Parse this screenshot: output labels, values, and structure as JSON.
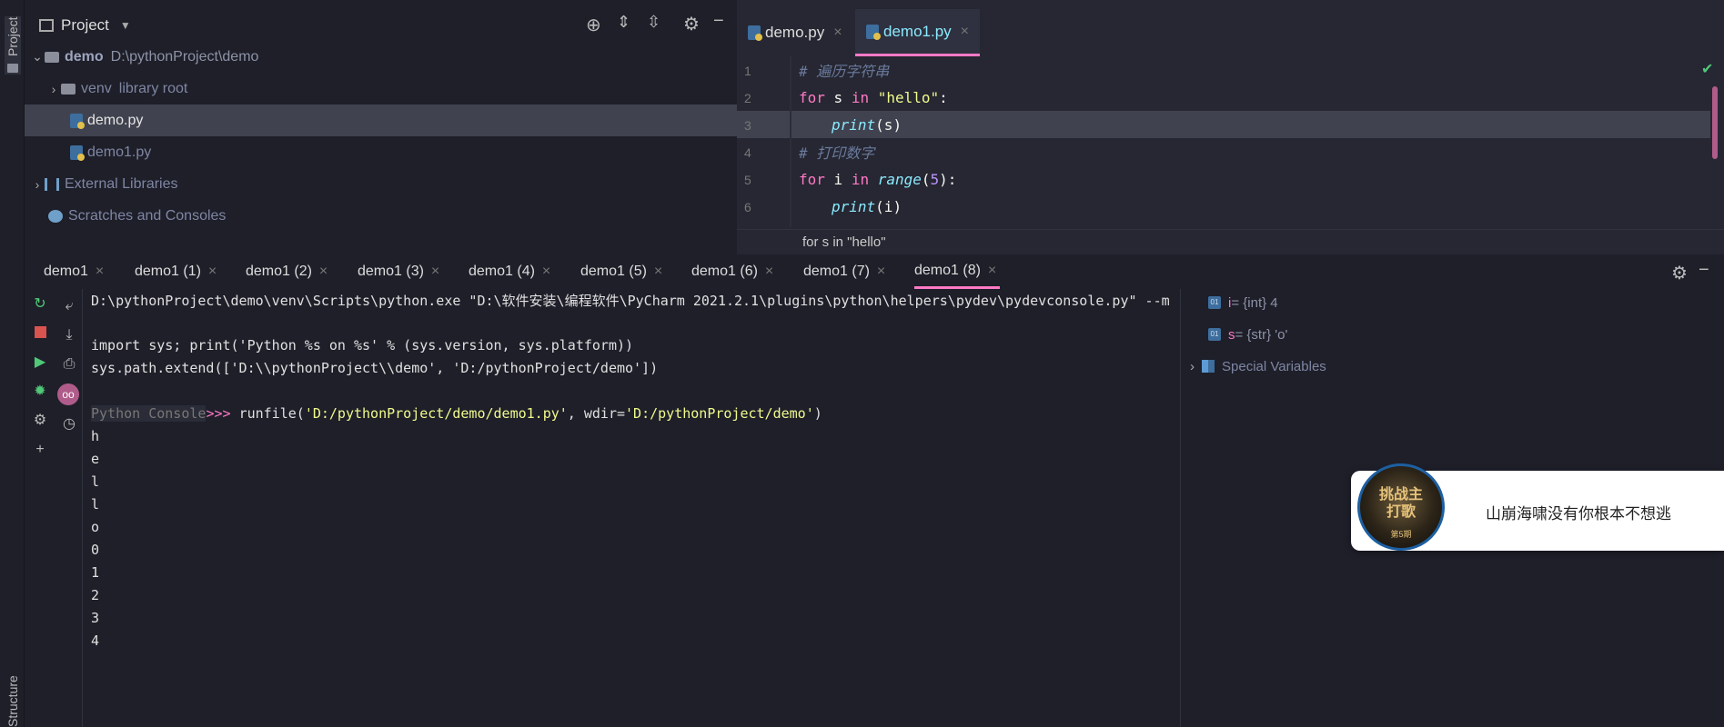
{
  "sidebar": {
    "project_label": "Project",
    "structure_label": "Structure"
  },
  "project_panel": {
    "title": "Project",
    "tree": [
      {
        "name": "demo",
        "path": "D:\\pythonProject\\demo"
      },
      {
        "name": "venv",
        "suffix": "library root"
      },
      {
        "name": "demo.py"
      },
      {
        "name": "demo1.py"
      },
      {
        "name": "External Libraries"
      },
      {
        "name": "Scratches and Consoles"
      }
    ]
  },
  "editor": {
    "tabs": [
      {
        "label": "demo.py"
      },
      {
        "label": "demo1.py",
        "active": true
      }
    ],
    "line_numbers": [
      "1",
      "2",
      "3",
      "4",
      "5",
      "6"
    ],
    "code": {
      "l1": "# 遍历字符串",
      "l2_kw": "for",
      "l2_var": " s ",
      "l2_in": "in",
      "l2_str": " \"hello\"",
      "l2_colon": ":",
      "l3_fn": "print",
      "l3_rest": "(s)",
      "l4": "# 打印数字",
      "l5_kw": "for",
      "l5_var": " i ",
      "l5_in": "in",
      "l5_fn": " range",
      "l5_open": "(",
      "l5_num": "5",
      "l5_close": "):",
      "l6_fn": "print",
      "l6_rest": "(i)"
    },
    "breadcrumb": "for s in \"hello\""
  },
  "run_tabs": [
    "demo1",
    "demo1 (1)",
    "demo1 (2)",
    "demo1 (3)",
    "demo1 (4)",
    "demo1 (5)",
    "demo1 (6)",
    "demo1 (7)",
    "demo1 (8)"
  ],
  "console": {
    "cmd": "D:\\pythonProject\\demo\\venv\\Scripts\\python.exe \"D:\\软件安装\\编程软件\\PyCharm 2021.2.1\\plugins\\python\\helpers\\pydev\\pydevconsole.py\" --m",
    "l1": "import sys; print('Python %s on %s' % (sys.version, sys.platform))",
    "l2": "sys.path.extend(['D:\\\\pythonProject\\\\demo', 'D:/pythonProject/demo'])",
    "prompt_label": "Python Console",
    "prompt": ">>> ",
    "run_fn": "runfile(",
    "run_arg1": "'D:/pythonProject/demo/demo1.py'",
    "run_mid": ", wdir=",
    "run_arg2": "'D:/pythonProject/demo'",
    "run_end": ")",
    "output": [
      "h",
      "e",
      "l",
      "l",
      "o",
      "0",
      "1",
      "2",
      "3",
      "4"
    ]
  },
  "variables": [
    {
      "name": "i",
      "value": " = {int} 4"
    },
    {
      "name": "s",
      "value": " = {str} 'o'"
    }
  ],
  "special_variables": "Special Variables",
  "toast": {
    "avatar_text": "挑战主打歌",
    "avatar_sub": "第5期",
    "message": "山崩海啸没有你根本不想逃"
  }
}
